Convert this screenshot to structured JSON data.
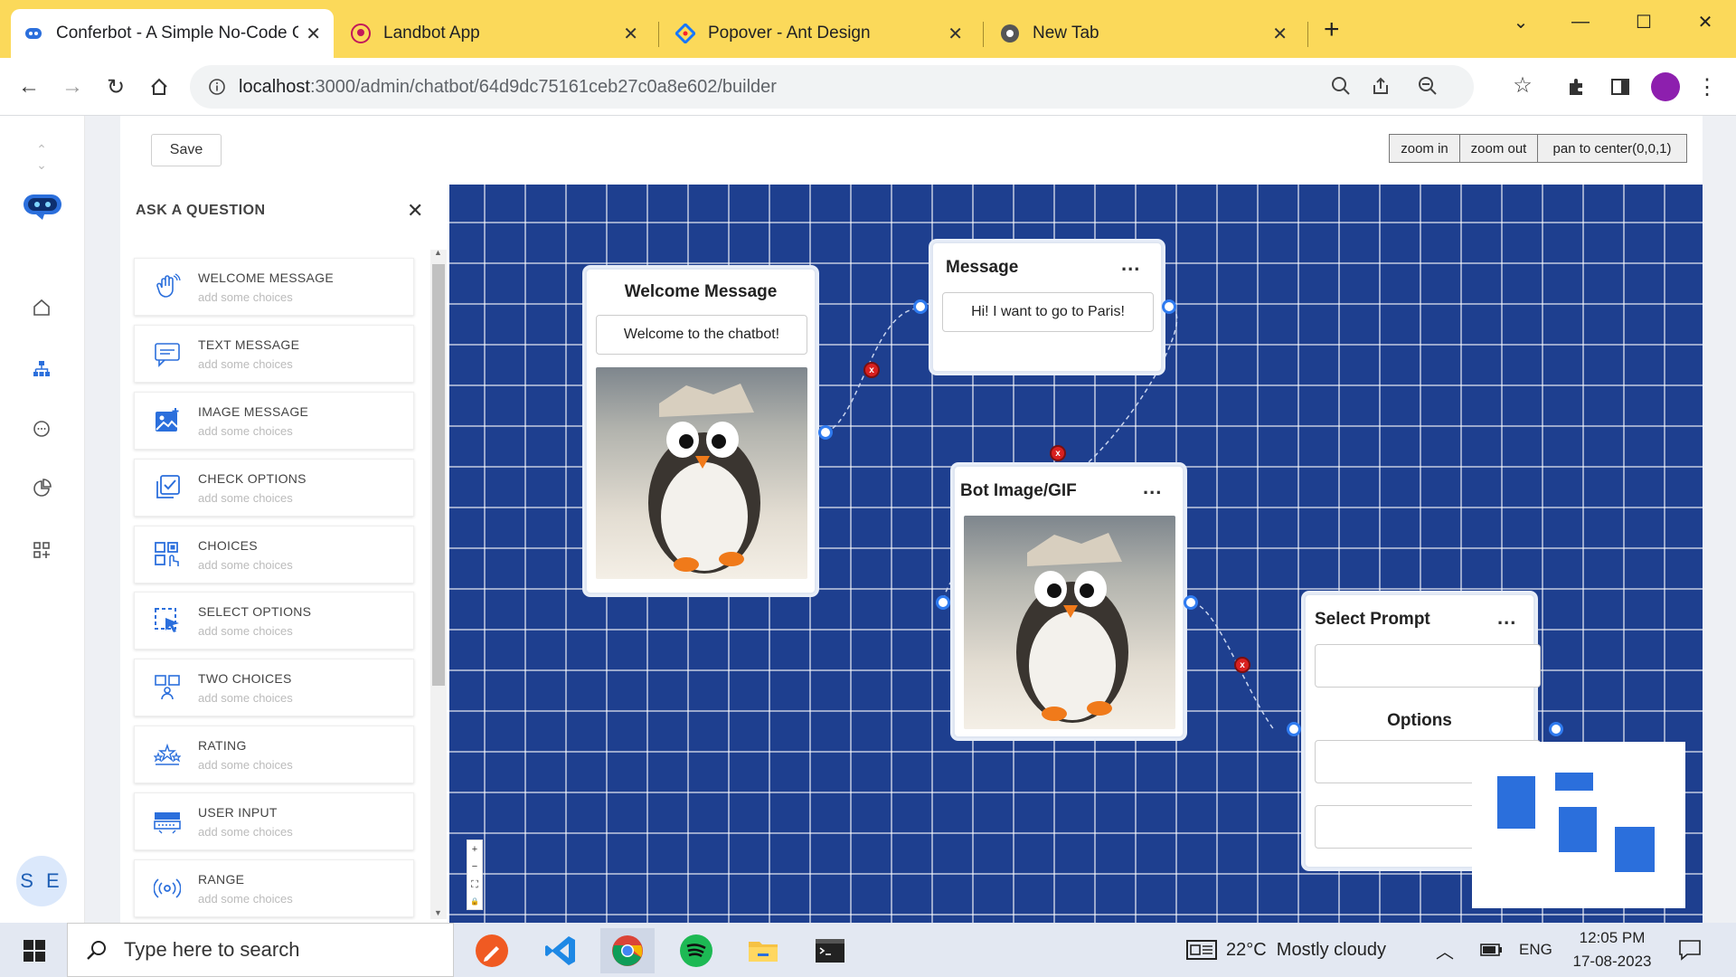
{
  "browser": {
    "tabs": [
      {
        "title": "Conferbot - A Simple No-Code C",
        "active": true,
        "icon": "conferbot-icon"
      },
      {
        "title": "Landbot App",
        "active": false,
        "icon": "landbot-icon"
      },
      {
        "title": "Popover - Ant Design",
        "active": false,
        "icon": "antdesign-icon"
      },
      {
        "title": "New Tab",
        "active": false,
        "icon": "chrome-icon"
      }
    ],
    "new_tab": "+",
    "address_host": "localhost",
    "address_path": ":3000/admin/chatbot/64d9dc75161ceb27c0a8e602/builder"
  },
  "toolbar": {
    "save_label": "Save",
    "zoom_in_label": "zoom in",
    "zoom_out_label": "zoom out",
    "pan_label": "pan to center(0,0,1)"
  },
  "sidebar": {
    "avatar_initials": "S E",
    "icons": [
      "home-icon",
      "flow-icon",
      "chat-icon",
      "analytics-icon",
      "apps-icon"
    ]
  },
  "panel": {
    "title": "ASK A QUESTION",
    "items": [
      {
        "label": "WELCOME MESSAGE",
        "sub": "add some choices",
        "icon": "wave-hand-icon"
      },
      {
        "label": "TEXT MESSAGE",
        "sub": "add some choices",
        "icon": "message-icon"
      },
      {
        "label": "IMAGE MESSAGE",
        "sub": "add some choices",
        "icon": "image-icon"
      },
      {
        "label": "CHECK OPTIONS",
        "sub": "add some choices",
        "icon": "checkbox-icon"
      },
      {
        "label": "CHOICES",
        "sub": "add some choices",
        "icon": "choices-icon"
      },
      {
        "label": "SELECT OPTIONS",
        "sub": "add some choices",
        "icon": "select-icon"
      },
      {
        "label": "TWO CHOICES",
        "sub": "add some choices",
        "icon": "two-choices-icon"
      },
      {
        "label": "RATING",
        "sub": "add some choices",
        "icon": "rating-icon"
      },
      {
        "label": "USER INPUT",
        "sub": "add some choices",
        "icon": "keyboard-icon"
      },
      {
        "label": "RANGE",
        "sub": "add some choices",
        "icon": "range-icon"
      }
    ]
  },
  "nodes": {
    "welcome": {
      "title": "Welcome Message",
      "text": "Welcome to the chatbot!"
    },
    "message": {
      "title": "Message",
      "text": "Hi! I want to go to Paris!",
      "menu": "..."
    },
    "botimage": {
      "title": "Bot Image/GIF",
      "menu": "..."
    },
    "select": {
      "title": "Select Prompt",
      "options_label": "Options",
      "menu": "..."
    }
  },
  "canvas_controls": [
    "+",
    "−",
    "⛶",
    "🔒"
  ],
  "taskbar": {
    "search_placeholder": "Type here to search",
    "weather": "22°C  Mostly cloudy",
    "lang": "ENG",
    "time": "12:05 PM",
    "date": "17-08-2023"
  },
  "colors": {
    "tabbar": "#fbd95a",
    "canvas": "#1e3f8f",
    "handle": "#2f7bf0",
    "delete": "#d9201f",
    "accent_blue": "#2b6fdc"
  }
}
